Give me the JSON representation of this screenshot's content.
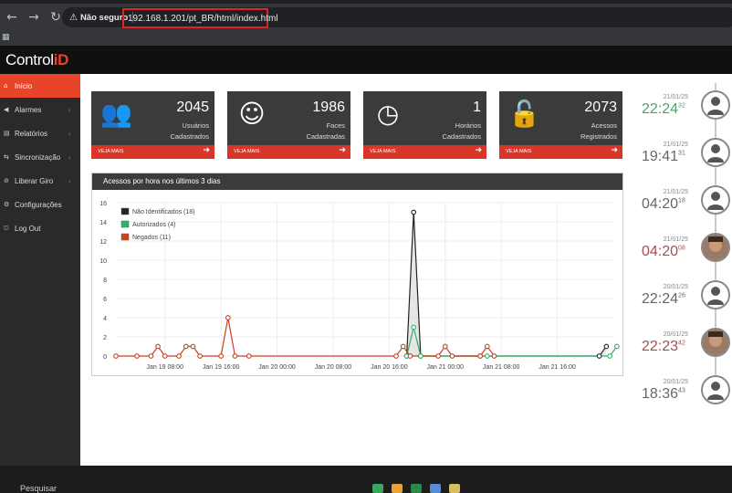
{
  "browser": {
    "security_label": "Não seguro",
    "url": "192.168.1.201/pt_BR/html/index.html"
  },
  "app": {
    "logo_main": "Control",
    "logo_accent": "iD"
  },
  "sidebar": {
    "items": [
      {
        "label": "Início",
        "icon": "home-icon",
        "glyph": "⌂"
      },
      {
        "label": "Alarmes",
        "icon": "megaphone-icon",
        "glyph": "◀"
      },
      {
        "label": "Relatórios",
        "icon": "report-icon",
        "glyph": "▤"
      },
      {
        "label": "Sincronização",
        "icon": "sync-icon",
        "glyph": "⇆"
      },
      {
        "label": "Liberar Giro",
        "icon": "turnstile-icon",
        "glyph": "⊘"
      },
      {
        "label": "Configurações",
        "icon": "gear-icon",
        "glyph": "⚙"
      },
      {
        "label": "Log Out",
        "icon": "logout-icon",
        "glyph": "⎋"
      }
    ]
  },
  "stats": [
    {
      "value": "2045",
      "line1": "Usuários",
      "line2": "Cadastrados",
      "more": "VEJA MAIS",
      "icon": "users-icon",
      "glyph": "👥"
    },
    {
      "value": "1986",
      "line1": "Faces",
      "line2": "Cadastradas",
      "more": "VEJA MAIS",
      "icon": "smiley-icon",
      "glyph": "☺"
    },
    {
      "value": "1",
      "line1": "Horários",
      "line2": "Cadastrados",
      "more": "VEJA MAIS",
      "icon": "clock-icon",
      "glyph": "◷"
    },
    {
      "value": "2073",
      "line1": "Acessos",
      "line2": "Registrados",
      "more": "VEJA MAIS",
      "icon": "unlock-icon",
      "glyph": "🔓"
    }
  ],
  "chart_panel": {
    "title": "Acessos por hora nos últimos 3 dias"
  },
  "chart_data": {
    "type": "line",
    "title": "Acessos por hora nos últimos 3 dias",
    "xlabel": "",
    "ylabel": "",
    "ylim": [
      0,
      16
    ],
    "yticks": [
      0,
      2,
      4,
      6,
      8,
      10,
      12,
      14,
      16
    ],
    "xticks": [
      "Jan 19 08:00",
      "Jan 19 16:00",
      "Jan 20 00:00",
      "Jan 20 08:00",
      "Jan 20 16:00",
      "Jan 21 00:00",
      "Jan 21 08:00",
      "Jan 21 16:00"
    ],
    "xtick_hours": [
      8,
      16,
      24,
      32,
      40,
      48,
      56,
      64
    ],
    "xrange_hours": [
      1,
      72
    ],
    "grid": true,
    "legend_position": "top-left",
    "series": [
      {
        "name": "Não Identificados (18)",
        "color": "#222222",
        "points": [
          [
            42.5,
            0
          ],
          [
            43.5,
            15
          ],
          [
            44.5,
            0
          ],
          [
            70,
            0
          ],
          [
            71,
            1
          ]
        ]
      },
      {
        "name": "Autorizados (4)",
        "color": "#2db36a",
        "points": [
          [
            42.5,
            0
          ],
          [
            43.5,
            3
          ],
          [
            44.5,
            0
          ],
          [
            53,
            0
          ],
          [
            54,
            0
          ],
          [
            71.5,
            0
          ],
          [
            72.5,
            1
          ]
        ]
      },
      {
        "name": "Negados (11)",
        "color": "#c9411f",
        "points": [
          [
            1,
            0
          ],
          [
            4,
            0
          ],
          [
            6,
            0
          ],
          [
            7,
            1
          ],
          [
            8,
            0
          ],
          [
            10,
            0
          ],
          [
            11,
            1
          ],
          [
            12,
            1
          ],
          [
            13,
            0
          ],
          [
            16,
            0
          ],
          [
            17,
            4
          ],
          [
            18,
            0
          ],
          [
            20,
            0
          ],
          [
            41,
            0
          ],
          [
            42,
            1
          ],
          [
            43,
            0
          ],
          [
            47,
            0
          ],
          [
            48,
            1
          ],
          [
            49,
            0
          ],
          [
            53,
            0
          ],
          [
            54,
            1
          ],
          [
            55,
            0
          ]
        ]
      }
    ]
  },
  "recent": [
    {
      "date": "21/01/25",
      "time": "22:24",
      "sec": "32",
      "color": "green",
      "photo": false
    },
    {
      "date": "21/01/25",
      "time": "19:41",
      "sec": "31",
      "color": "gray",
      "photo": false
    },
    {
      "date": "21/01/25",
      "time": "04:20",
      "sec": "18",
      "color": "gray",
      "photo": false
    },
    {
      "date": "21/01/25",
      "time": "04:20",
      "sec": "08",
      "color": "red",
      "photo": true
    },
    {
      "date": "20/01/25",
      "time": "22:24",
      "sec": "26",
      "color": "gray",
      "photo": false
    },
    {
      "date": "20/01/25",
      "time": "22:23",
      "sec": "42",
      "color": "red",
      "photo": true
    },
    {
      "date": "20/01/25",
      "time": "18:36",
      "sec": "43",
      "color": "gray",
      "photo": false
    }
  ],
  "taskbar": {
    "search_placeholder": "Pesquisar"
  }
}
